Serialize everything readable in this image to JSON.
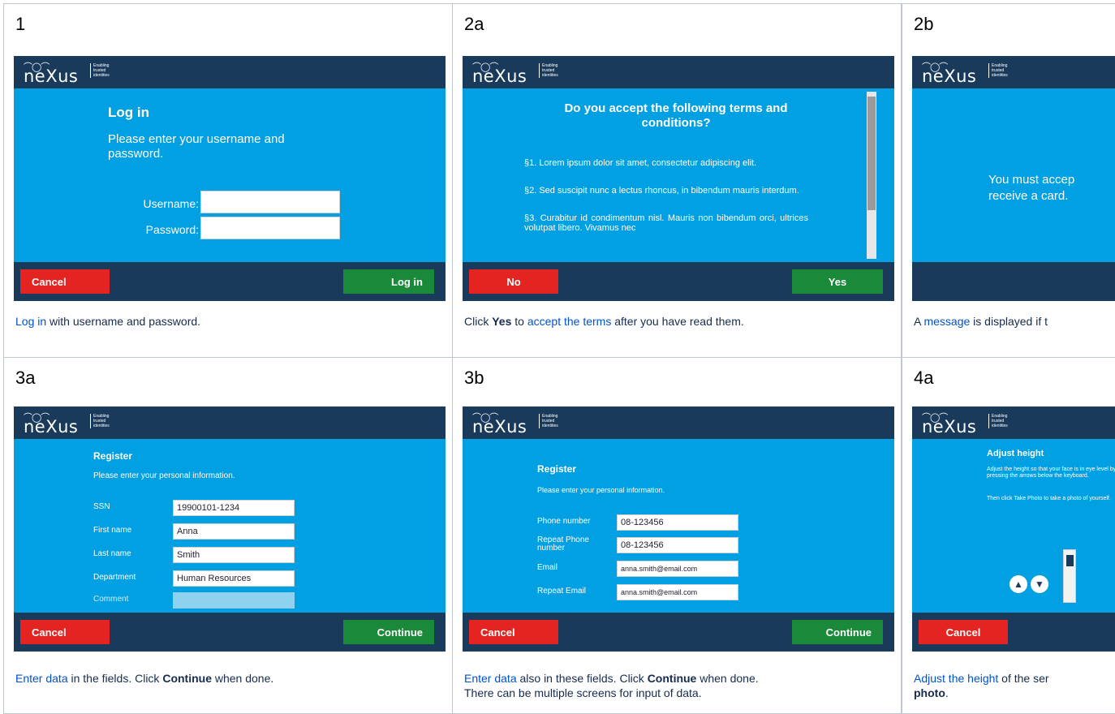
{
  "logo": {
    "name": "neXus",
    "tagline": "Enabling trusted identities"
  },
  "panels": [
    {
      "id": "1",
      "title": "Log in",
      "subtitle": "Please enter your username and password.",
      "fields": [
        {
          "label": "Username:",
          "value": ""
        },
        {
          "label": "Password:",
          "value": ""
        }
      ],
      "left_button": "Cancel",
      "right_button": "Log in",
      "caption_link": "Log in",
      "caption_rest": " with username and password."
    },
    {
      "id": "2a",
      "title": "Do you accept the following terms and conditions?",
      "paragraphs": [
        "§1. Lorem ipsum dolor sit amet, consectetur adipiscing elit.",
        "§2. Sed suscipit nunc a lectus rhoncus, in bibendum mauris interdum.",
        "§3. Curabitur id condimentum nisl. Mauris non bibendum orci, ultrices volutpat libero. Vivamus nec"
      ],
      "left_button": "No",
      "right_button": "Yes",
      "caption_pre": "Click ",
      "caption_bold": "Yes",
      "caption_mid": " to ",
      "caption_link": "accept the terms",
      "caption_rest": " after you have read them."
    },
    {
      "id": "2b",
      "message": "You must accept the terms to receive a card.",
      "message_line1": "You must accep",
      "message_line2": "receive a card.",
      "caption_pre": "A ",
      "caption_link": "message",
      "caption_rest": " is displayed if t"
    },
    {
      "id": "3a",
      "title": "Register",
      "subtitle": "Please enter your personal information.",
      "fields": [
        {
          "label": "SSN",
          "value": "19900101-1234"
        },
        {
          "label": "First name",
          "value": "Anna"
        },
        {
          "label": "Last name",
          "value": "Smith"
        },
        {
          "label": "Department",
          "value": "Human Resources"
        },
        {
          "label": "Comment",
          "value": ""
        }
      ],
      "left_button": "Cancel",
      "right_button": "Continue",
      "caption_link": "Enter data",
      "caption_mid": " in the fields. Click ",
      "caption_bold": "Continue",
      "caption_rest": " when done."
    },
    {
      "id": "3b",
      "title": "Register",
      "subtitle": "Please enter your personal information.",
      "fields": [
        {
          "label": "Phone number",
          "value": "08-123456"
        },
        {
          "label": "Repeat Phone number",
          "value": "08-123456"
        },
        {
          "label": "Email",
          "value": "anna.smith@email.com"
        },
        {
          "label": "Repeat Email",
          "value": "anna.smith@email.com"
        }
      ],
      "left_button": "Cancel",
      "right_button": "Continue",
      "caption_link": "Enter data",
      "caption_mid": " also in these fields. Click ",
      "caption_bold": "Continue",
      "caption_rest": " when done.",
      "caption_line2": "There can be multiple screens for input of data."
    },
    {
      "id": "4a",
      "title": "Adjust height",
      "text1": "Adjust the height so that your face is in eye level by pressing the arrows below the keyboard.",
      "text2": "Then click Take Photo to take a photo of yourself.",
      "left_button": "Cancel",
      "caption_link": "Adjust the height",
      "caption_rest": " of the ser",
      "caption_line2": "photo",
      "caption_line2_end": "."
    }
  ]
}
